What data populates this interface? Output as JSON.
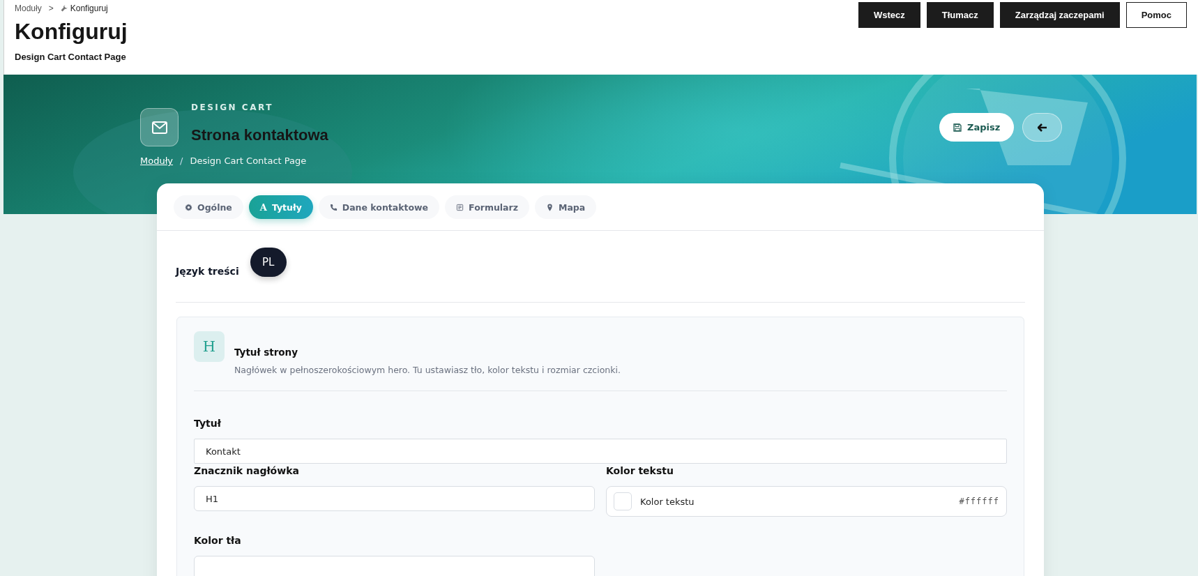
{
  "breadcrumb": {
    "items": [
      "Moduły",
      "Konfiguruj"
    ],
    "separator": ">"
  },
  "header": {
    "title": "Konfiguruj",
    "subtitle": "Design Cart Contact Page"
  },
  "actions": [
    {
      "label": "Wstecz",
      "kind": "primary"
    },
    {
      "label": "Tłumacz",
      "kind": "primary"
    },
    {
      "label": "Zarządzaj zaczepami",
      "kind": "primary"
    },
    {
      "label": "Pomoc",
      "kind": "outline"
    }
  ],
  "hero": {
    "eyebrow": "DESIGN CART",
    "title": "Strona kontaktowa",
    "crumb_link": "Moduły",
    "crumb_separator": "/",
    "crumb_current": "Design Cart Contact Page",
    "save_button": "Zapisz"
  },
  "tabs": [
    {
      "label": "Ogólne",
      "selected": false
    },
    {
      "label": "Tytuły",
      "glyph": "A",
      "selected": true
    },
    {
      "label": "Dane kontaktowe",
      "selected": false
    },
    {
      "label": "Formularz",
      "selected": false
    },
    {
      "label": "Mapa",
      "selected": false
    }
  ],
  "language": {
    "label": "Język treści",
    "value": "PL"
  },
  "section": {
    "badge": "H",
    "title": "Tytuł strony",
    "description": "Nagłówek w pełnoszerokościowym hero. Tu ustawiasz tło, kolor tekstu i rozmiar czcionki."
  },
  "fields": [
    {
      "label": "Tytuł",
      "kind": "text",
      "value": "Kontakt"
    },
    {
      "label": "Znacznik nagłówka",
      "kind": "text",
      "value": "H1"
    },
    {
      "label": "Kolor tekstu",
      "kind": "color",
      "text": "Kolor tekstu",
      "value": "#ffffff"
    },
    {
      "label": "Kolor tła",
      "kind": "text"
    }
  ]
}
